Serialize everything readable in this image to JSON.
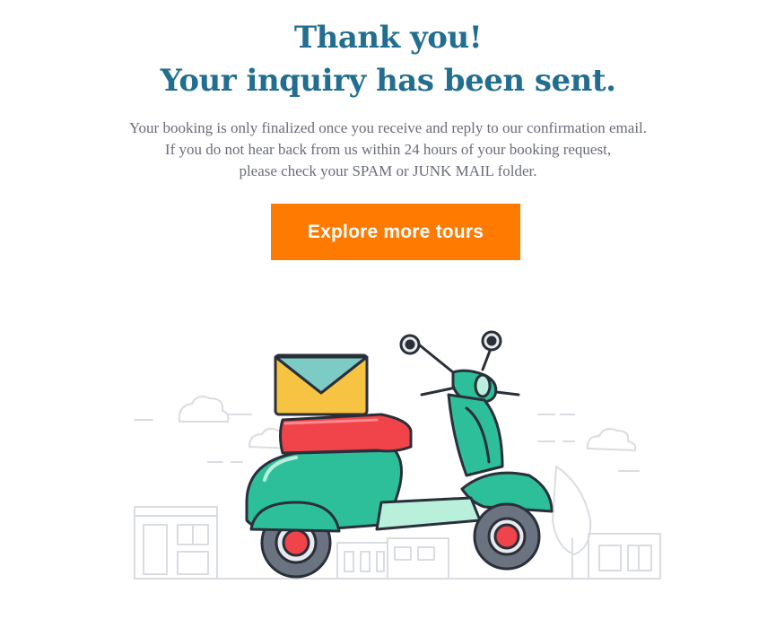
{
  "confirmation": {
    "title_line1": "Thank you!",
    "title_line2": "Your inquiry has been sent.",
    "message_lines": [
      "Your booking is only finalized once you receive and reply to our confirmation email.",
      "If you do not hear back from us within 24 hours of your booking request,",
      "please check your SPAM or JUNK MAIL folder."
    ],
    "button_label": "Explore more tours"
  },
  "colors": {
    "heading": "#226e90",
    "button": "#ff7a00",
    "scooter_body": "#2dbf9a",
    "seat": "#f0444a",
    "envelope": "#f6c343"
  },
  "illustration": {
    "icon": "scooter-with-envelope-icon"
  }
}
